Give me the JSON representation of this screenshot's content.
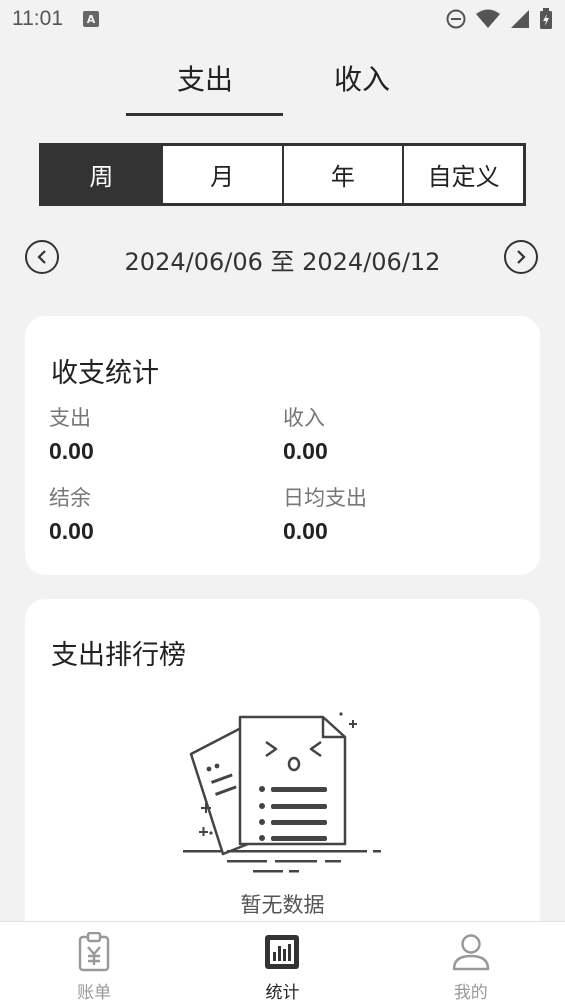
{
  "status_bar": {
    "time": "11:01",
    "a_badge": "A",
    "icons": [
      "do-not-disturb-icon",
      "wifi-icon",
      "signal-icon",
      "battery-charging-icon"
    ]
  },
  "top_tabs": [
    {
      "label": "支出",
      "active": true
    },
    {
      "label": "收入",
      "active": false
    }
  ],
  "period_segments": [
    {
      "label": "周",
      "active": true
    },
    {
      "label": "月",
      "active": false
    },
    {
      "label": "年",
      "active": false
    },
    {
      "label": "自定义",
      "active": false
    }
  ],
  "date_range": {
    "text": "2024/06/06 至 2024/06/12",
    "prev_icon": "chevron-left-circle-icon",
    "next_icon": "chevron-right-circle-icon"
  },
  "stats_card": {
    "title": "收支统计",
    "items": [
      {
        "label": "支出",
        "value": "0.00"
      },
      {
        "label": "收入",
        "value": "0.00"
      },
      {
        "label": "结余",
        "value": "0.00"
      },
      {
        "label": "日均支出",
        "value": "0.00"
      }
    ]
  },
  "ranking_card": {
    "title": "支出排行榜",
    "empty_text": "暂无数据",
    "empty_icon": "empty-documents-illustration"
  },
  "bottom_nav": [
    {
      "label": "账单",
      "icon": "bill-clipboard-icon",
      "active": false
    },
    {
      "label": "统计",
      "icon": "bar-chart-icon",
      "active": true
    },
    {
      "label": "我的",
      "icon": "user-icon",
      "active": false
    }
  ],
  "colors": {
    "background": "#f2f2f2",
    "card": "#ffffff",
    "accent": "#333333",
    "muted_text": "#777777",
    "inactive_nav": "#999999"
  }
}
